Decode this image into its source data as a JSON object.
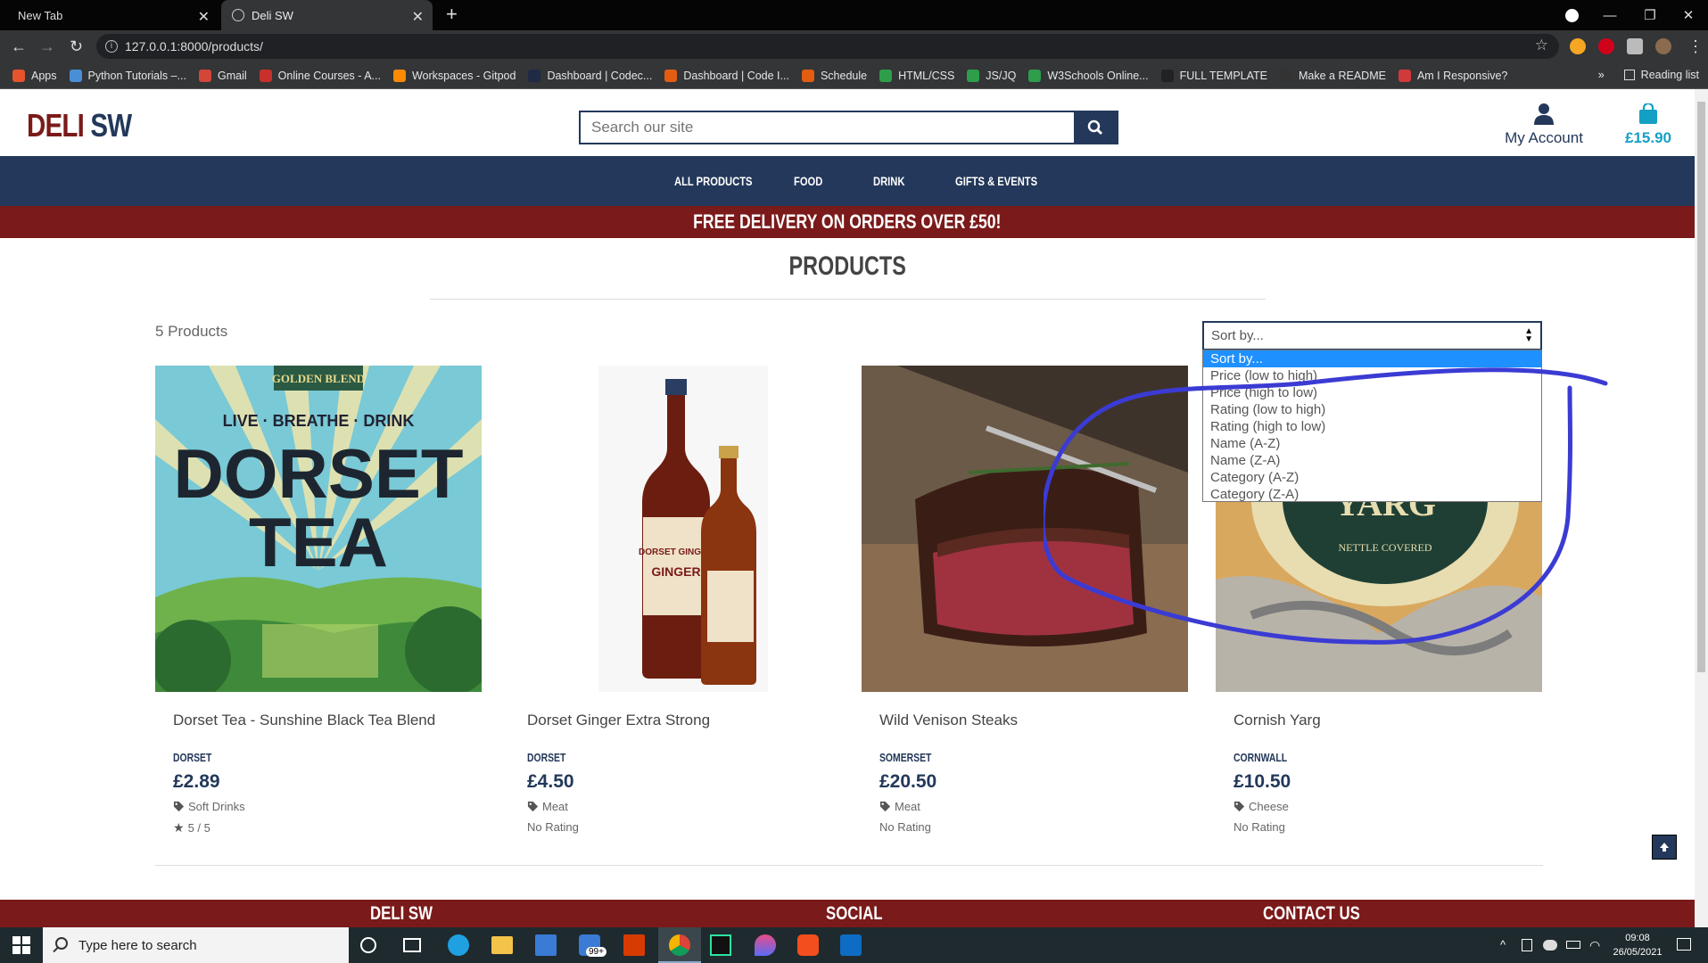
{
  "browser": {
    "tabs": [
      {
        "label": "New Tab"
      },
      {
        "label": "Deli SW"
      }
    ],
    "url": "127.0.0.1:8000/products/",
    "bookmarks": [
      {
        "label": "Apps",
        "color": "#e5542d"
      },
      {
        "label": "Python Tutorials –...",
        "color": "#4a8fd6"
      },
      {
        "label": "Gmail",
        "color": "#d44638"
      },
      {
        "label": "Online Courses - A...",
        "color": "#c9302c"
      },
      {
        "label": "Workspaces - Gitpod",
        "color": "#ff8a00"
      },
      {
        "label": "Dashboard | Codec...",
        "color": "#1f2a44"
      },
      {
        "label": "Dashboard | Code I...",
        "color": "#e25d12"
      },
      {
        "label": "Schedule",
        "color": "#e25d12"
      },
      {
        "label": "HTML/CSS",
        "color": "#2e9e4b"
      },
      {
        "label": "JS/JQ",
        "color": "#2e9e4b"
      },
      {
        "label": "W3Schools Online...",
        "color": "#2e9e4b"
      },
      {
        "label": "FULL TEMPLATE",
        "color": "#222222"
      },
      {
        "label": "Make a README",
        "color": "#333333"
      },
      {
        "label": "Am I Responsive?",
        "color": "#d03a3a"
      }
    ],
    "reading_list": "Reading list"
  },
  "site": {
    "logo_part1": "DELI",
    "logo_part2": "SW",
    "search_placeholder": "Search our site",
    "account_label": "My Account",
    "bag_total": "£15.90",
    "nav": [
      "ALL PRODUCTS",
      "FOOD",
      "DRINK",
      "GIFTS & EVENTS"
    ],
    "banner": "FREE DELIVERY ON ORDERS OVER £50!",
    "heading": "PRODUCTS",
    "count_label": "5 Products",
    "sort": {
      "selected": "Sort by...",
      "options": [
        "Sort by...",
        "Price (low to high)",
        "Price (high to low)",
        "Rating (low to high)",
        "Rating (high to low)",
        "Name (A-Z)",
        "Name (Z-A)",
        "Category (A-Z)",
        "Category (Z-A)"
      ]
    },
    "products": [
      {
        "title": "Dorset Tea - Sunshine Black Tea Blend",
        "region": "DORSET",
        "price": "£2.89",
        "category": "Soft Drinks",
        "rating": "5 / 5",
        "image_text": {
          "top": "GOLDEN BLEND",
          "tag": "LIVE · BREATHE · DRINK",
          "name1": "DORSET",
          "name2": "TEA"
        }
      },
      {
        "title": "Dorset Ginger Extra Strong",
        "region": "DORSET",
        "price": "£4.50",
        "category": "Meat",
        "rating": "No Rating",
        "image_text": {
          "label1": "DORSET GINGER",
          "label2": "GINGER"
        }
      },
      {
        "title": "Wild Venison Steaks",
        "region": "SOMERSET",
        "price": "£20.50",
        "category": "Meat",
        "rating": "No Rating"
      },
      {
        "title": "Cornish Yarg",
        "region": "CORNWALL",
        "price": "£10.50",
        "category": "Cheese",
        "rating": "No Rating",
        "image_text": {
          "label1": "YARG",
          "label2": "NETTLE COVERED"
        }
      }
    ],
    "footer": [
      "DELI SW",
      "SOCIAL",
      "CONTACT US"
    ]
  },
  "taskbar": {
    "search_placeholder": "Type here to search",
    "badge": "99+",
    "time": "09:08",
    "date": "26/05/2021"
  },
  "colors": {
    "navy": "#23385a",
    "maroon": "#7a1a1a",
    "accent": "#14a0c4",
    "annotation": "#3b3bd4"
  }
}
